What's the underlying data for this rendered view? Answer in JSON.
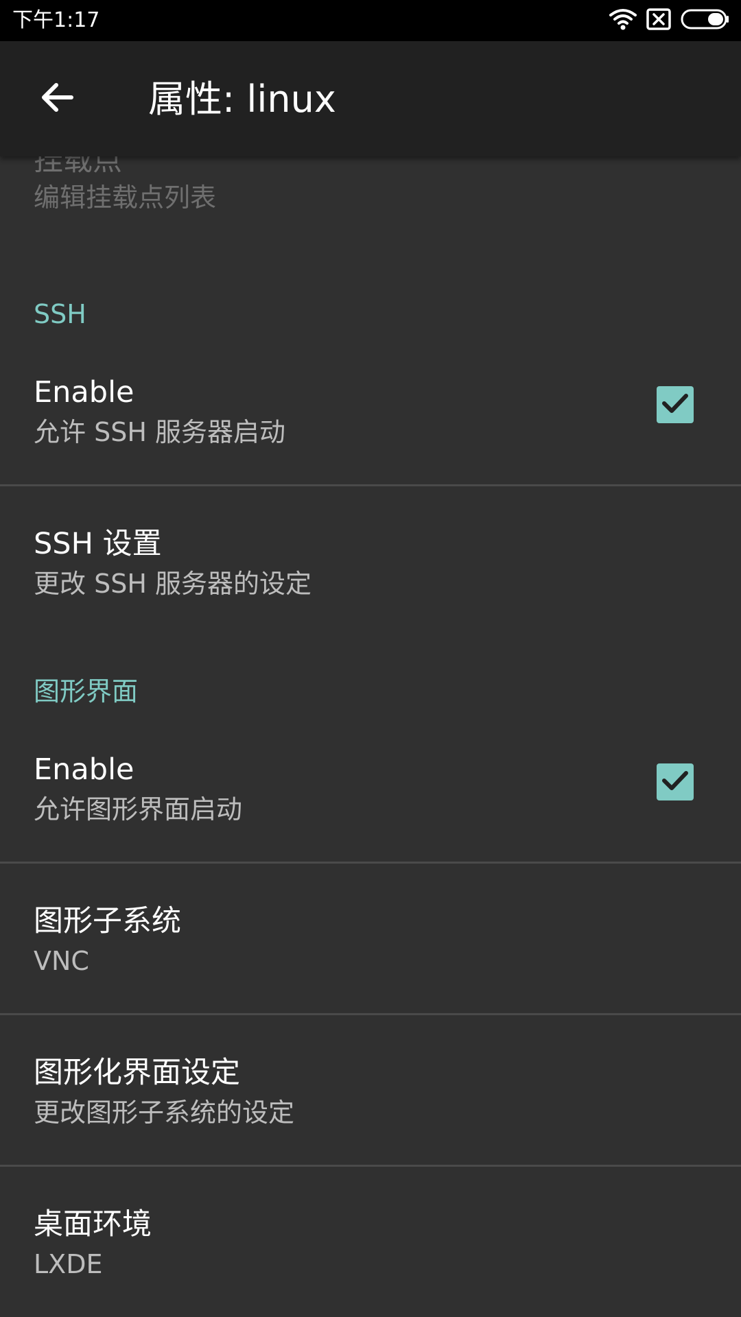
{
  "status_bar": {
    "time": "下午1:17",
    "icons": [
      "wifi-icon",
      "sim-error-icon",
      "battery-icon"
    ]
  },
  "app_bar": {
    "title": "属性: linux",
    "back_icon": "arrow-back-icon"
  },
  "colors": {
    "background": "#303030",
    "app_bar": "#212121",
    "accent": "#80cbc4",
    "divider": "#4a4a4a"
  },
  "mount_points": {
    "title": "挂载点",
    "summary": "编辑挂载点列表"
  },
  "ssh": {
    "category": "SSH",
    "enable": {
      "title": "Enable",
      "summary": "允许 SSH 服务器启动",
      "checked": true
    },
    "settings": {
      "title": "SSH 设置",
      "summary": "更改 SSH 服务器的设定"
    }
  },
  "gui": {
    "category": "图形界面",
    "enable": {
      "title": "Enable",
      "summary": "允许图形界面启动",
      "checked": true
    },
    "subsystem": {
      "title": "图形子系统",
      "value": "VNC"
    },
    "settings": {
      "title": "图形化界面设定",
      "summary": "更改图形子系统的设定"
    },
    "desktop": {
      "title": "桌面环境",
      "value": "LXDE"
    }
  }
}
